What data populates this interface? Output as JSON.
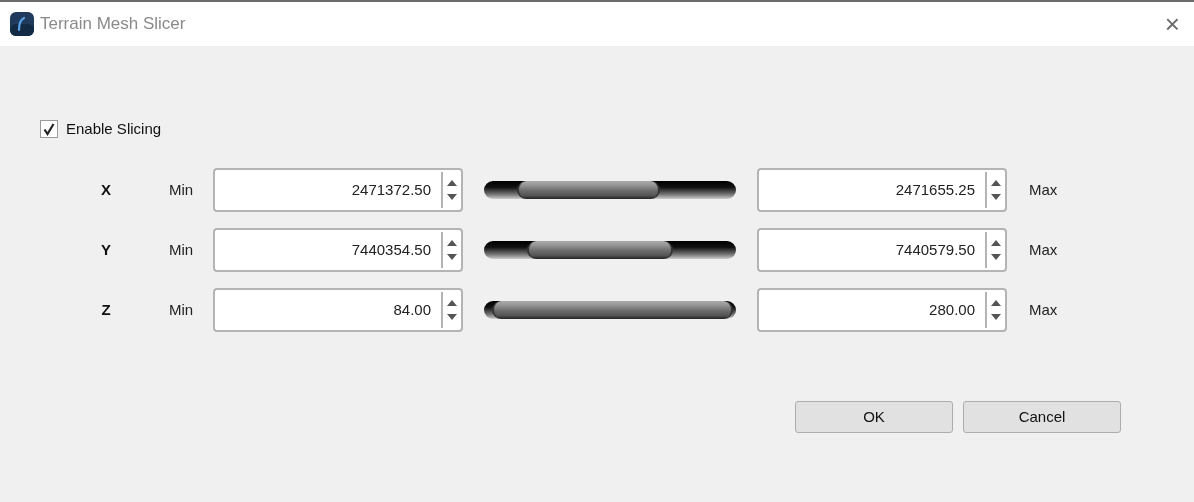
{
  "window": {
    "title": "Terrain Mesh Slicer",
    "close": "×"
  },
  "enable_slicing": {
    "label": "Enable Slicing",
    "checked": true
  },
  "axes": [
    {
      "axis": "X",
      "min_label": "Min",
      "min_value": "2471372.50",
      "max_value": "2471655.25",
      "max_label": "Max"
    },
    {
      "axis": "Y",
      "min_label": "Min",
      "min_value": "7440354.50",
      "max_value": "7440579.50",
      "max_label": "Max"
    },
    {
      "axis": "Z",
      "min_label": "Min",
      "min_value": "84.00",
      "max_value": "280.00",
      "max_label": "Max"
    }
  ],
  "buttons": [
    "OK",
    "Cancel"
  ]
}
